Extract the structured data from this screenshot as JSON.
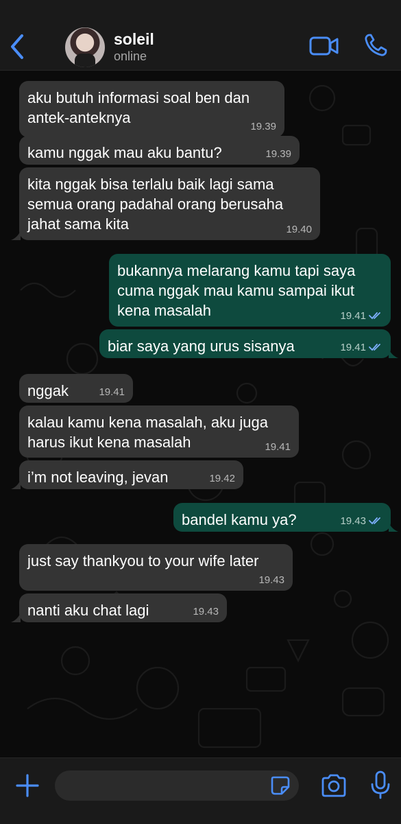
{
  "header": {
    "contact_name": "soleil",
    "status": "online",
    "back_icon": "chevron-left-icon",
    "video_icon": "video-camera-icon",
    "phone_icon": "phone-icon"
  },
  "colors": {
    "accent": "#4a8df8",
    "incoming_bubble": "#343434",
    "outgoing_bubble": "#0e4a3e",
    "background": "#0b0b0b"
  },
  "messages": [
    {
      "direction": "in",
      "text": "aku butuh informasi soal ben dan antek-anteknya",
      "time": "19.39"
    },
    {
      "direction": "in",
      "text": "kamu nggak mau aku bantu?",
      "time": "19.39"
    },
    {
      "direction": "in",
      "text": "kita nggak bisa terlalu baik lagi sama semua orang padahal orang berusaha jahat sama kita",
      "time": "19.40"
    },
    {
      "direction": "out",
      "text": "bukannya melarang kamu tapi saya cuma nggak mau kamu sampai ikut kena masalah",
      "time": "19.41",
      "status": "read"
    },
    {
      "direction": "out",
      "text": "biar saya yang urus sisanya",
      "time": "19.41",
      "status": "read"
    },
    {
      "direction": "in",
      "text": "nggak",
      "time": "19.41"
    },
    {
      "direction": "in",
      "text": "kalau kamu kena masalah, aku juga harus ikut kena masalah",
      "time": "19.41"
    },
    {
      "direction": "in",
      "text": "i’m not leaving, jevan",
      "time": "19.42"
    },
    {
      "direction": "out",
      "text": "bandel kamu ya?",
      "time": "19.43",
      "status": "read"
    },
    {
      "direction": "in",
      "text": "just say thankyou to your wife later",
      "time": "19.43"
    },
    {
      "direction": "in",
      "text": "nanti aku chat lagi",
      "time": "19.43"
    }
  ],
  "composer": {
    "placeholder": "",
    "value": "",
    "icons": [
      "plus-icon",
      "sticker-icon",
      "camera-icon",
      "microphone-icon"
    ]
  }
}
